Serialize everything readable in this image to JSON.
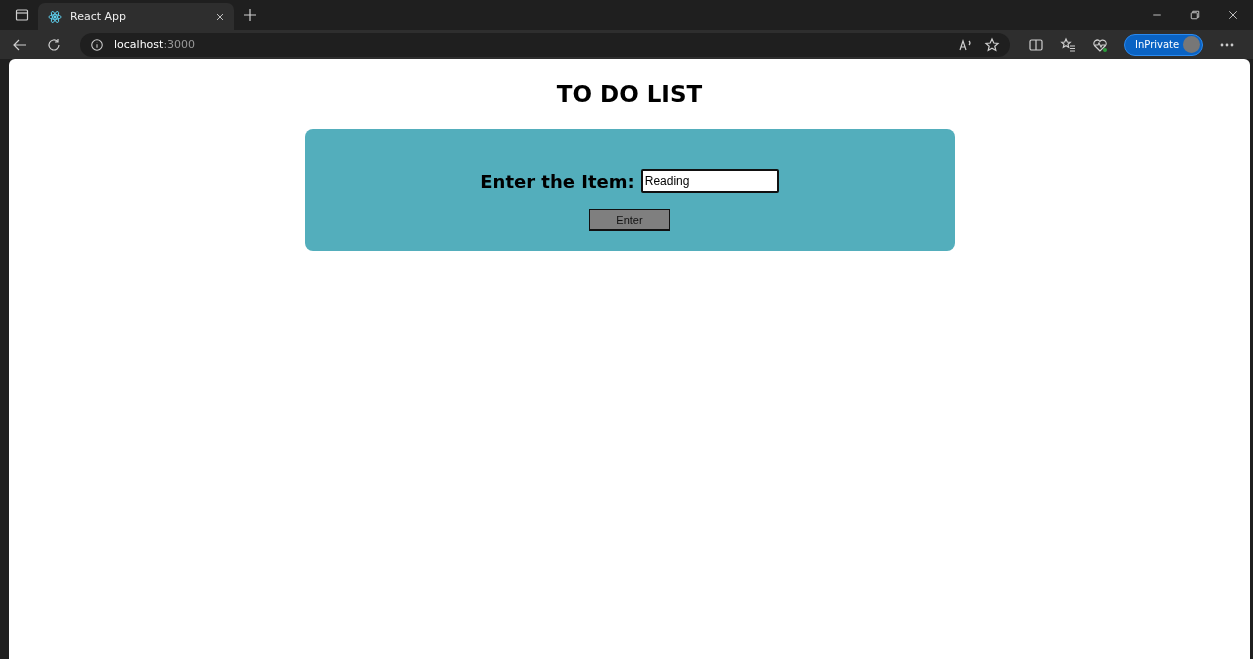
{
  "browser": {
    "tabs": [
      {
        "title": "React App",
        "selected": true
      }
    ],
    "address": {
      "host": "localhost",
      "port": ":3000"
    },
    "profile_button": "InPrivate"
  },
  "page": {
    "title": "TO DO LIST",
    "form": {
      "label": "Enter the Item:",
      "input_value": "Reading",
      "button": "Enter"
    }
  }
}
